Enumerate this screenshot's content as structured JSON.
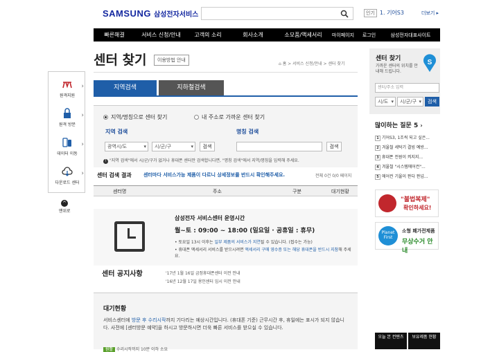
{
  "header": {
    "logo_text": "SAMSUNG",
    "logo_sub": "삼성전자서비스",
    "popular_badge": "인기",
    "popular_text": "1. 기어S3",
    "more_label": "더보기"
  },
  "nav": [
    "빠른해결",
    "서비스 신청/안내",
    "고객의 소리",
    "회사소개",
    "소모품/액세서리",
    "마이페이지",
    "로그인",
    "삼성전자대표사이트"
  ],
  "page": {
    "title": "센터 찾기",
    "how_button": "이용방법 안내",
    "breadcrumb": "⌂ 홈 > 서비스 신청/안내 > 센터 찾기"
  },
  "tabs": [
    "지역검색",
    "지하철검색"
  ],
  "search": {
    "radio1": "지역/명칭으로 센터 찾기",
    "radio2": "내 주소로 가까운 센터 찾기",
    "region_label": "지역 검색",
    "name_label": "명칭 검색",
    "city_select": "광역시/도",
    "district_select": "시/군/구",
    "search_button": "검색",
    "name_search_button": "검색",
    "help_text": "\"지역 검색\"에서 시/군/구가 없거나 휴대폰 센터만 검색합니다면, \"명칭 검색\"에서 지역/명칭을 입력해 주세요."
  },
  "results": {
    "label": "센터 검색 결과",
    "notice": "센터마다 서비스가능 제품이 다르니 상세정보를 반드시 확인해주세요.",
    "count": "전체 0건 0/0 페이지",
    "columns": [
      "센터명",
      "주소",
      "구분",
      "대기현황"
    ]
  },
  "hours": {
    "title": "삼성전자 서비스센터 운영시간",
    "time": "월~토 : 09:00 ~ 18:00 (일요일 · 공휴일 : 휴무)",
    "bullet1_a": "토요일 13시 이후는 ",
    "bullet1_b": "일부 제품의 서비스가 지연",
    "bullet1_c": "될 수 있습니다. (접수는 가능)",
    "bullet2_a": "휴대폰 액세서리 서비스를 받으시려면 ",
    "bullet2_b": "액세서리 구매 영수증 또는 해당 휴대폰을 반드시 지참",
    "bullet2_c": "해 주세요."
  },
  "center_notice": {
    "title": "센터 공지사항",
    "items": [
      "'17년 1월 16일 금정휴대폰센터 이전 안내",
      "'16년 12월 17일 용인센터 임시 이전 안내"
    ]
  },
  "wait": {
    "title": "대기현황",
    "text_a": "서비스센터에 ",
    "text_b": "방문 후 수리시작",
    "text_c": "까지 기다리는 예상시간입니다. (휴대폰 기준) 근무시간 후, 휴일에는 표시가 되지 않습니다. 사전에 [센터방문 예약]을 하시고 방문하시면 더욱 빠른 서비스를 받으실 수 있습니다.",
    "row_badge": "원활",
    "row_text": "수리시작까지 10분 이하 소요"
  },
  "left_float": {
    "items": [
      "원격지원",
      "원격 방문",
      "데이터 이동",
      "다운로드 센터"
    ],
    "top_label": "맨위로"
  },
  "right": {
    "title": "센터 찾기",
    "desc": "가까운 센터의 위치를 안내해 드립니다.",
    "placeholder": "센터/주소 입력",
    "city": "시/도",
    "district": "시/군/구",
    "search_button": "검색",
    "faq_title": "많이하는 질문 5",
    "faq": [
      "기어S3, 1조씩 되고 싶은...",
      "겨울철 세탁기 결빙 예방...",
      "휴대폰 전원이 켜지지...",
      "겨울철 \"시스템에어컨\"...",
      "에어컨 기울이 판다 판넘..."
    ],
    "banner1": "\"불법복제\"",
    "banner1_sub": "확인하세요!",
    "banner2_a": "Planet First",
    "banner2_b": "소형 폐가전제품",
    "banner2_c": "무상수거 안내",
    "bottom1": "오늘 본 컨텐츠",
    "bottom2": "보유제품 현황"
  }
}
